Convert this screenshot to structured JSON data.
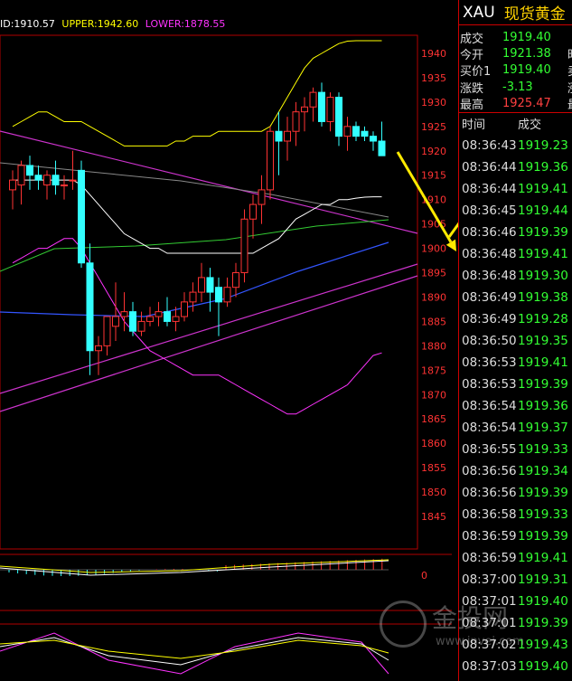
{
  "indicator": {
    "mid": "ID:1910.57",
    "upper": "UPPER:1942.60",
    "lower": "LOWER:1878.55",
    "colors": {
      "mid": "#ffffff",
      "upper": "#ffff00",
      "lower": "#ff33ff"
    }
  },
  "quote": {
    "symbol": "XAU",
    "name": "现货黄金",
    "rows": [
      {
        "label": "成交",
        "value": "1919.40",
        "extra": ""
      },
      {
        "label": "今开",
        "value": "1921.38",
        "extra": "昨"
      },
      {
        "label": "买价1",
        "value": "1919.40",
        "extra": "卖"
      },
      {
        "label": "涨跌",
        "value": "-3.13",
        "extra": "涨"
      },
      {
        "label": "最高",
        "value": "1925.47",
        "extra": "最"
      }
    ]
  },
  "ticks": {
    "header": {
      "time": "时间",
      "price": "成交"
    },
    "rows": [
      {
        "time": "08:36:43",
        "price": "1919.23"
      },
      {
        "time": "08:36:44",
        "price": "1919.36"
      },
      {
        "time": "08:36:44",
        "price": "1919.41"
      },
      {
        "time": "08:36:45",
        "price": "1919.44"
      },
      {
        "time": "08:36:46",
        "price": "1919.39"
      },
      {
        "time": "08:36:48",
        "price": "1919.41"
      },
      {
        "time": "08:36:48",
        "price": "1919.30"
      },
      {
        "time": "08:36:49",
        "price": "1919.38"
      },
      {
        "time": "08:36:49",
        "price": "1919.28"
      },
      {
        "time": "08:36:50",
        "price": "1919.35"
      },
      {
        "time": "08:36:53",
        "price": "1919.41"
      },
      {
        "time": "08:36:53",
        "price": "1919.39"
      },
      {
        "time": "08:36:54",
        "price": "1919.36"
      },
      {
        "time": "08:36:54",
        "price": "1919.37"
      },
      {
        "time": "08:36:55",
        "price": "1919.33"
      },
      {
        "time": "08:36:56",
        "price": "1919.34"
      },
      {
        "time": "08:36:56",
        "price": "1919.39"
      },
      {
        "time": "08:36:58",
        "price": "1919.33"
      },
      {
        "time": "08:36:59",
        "price": "1919.39"
      },
      {
        "time": "08:36:59",
        "price": "1919.41"
      },
      {
        "time": "08:37:00",
        "price": "1919.31"
      },
      {
        "time": "08:37:01",
        "price": "1919.40"
      },
      {
        "time": "08:37:01",
        "price": "1919.39"
      },
      {
        "time": "08:37:02",
        "price": "1919.43"
      },
      {
        "time": "08:37:03",
        "price": "1919.40"
      }
    ]
  },
  "watermark": {
    "text": "金投网",
    "url": "www.jnvei.com"
  },
  "chart_data": {
    "type": "candlestick",
    "ylim": [
      1840,
      1945
    ],
    "y_ticks": [
      1940,
      1935,
      1930,
      1925,
      1920,
      1915,
      1910,
      1905,
      1900,
      1895,
      1890,
      1885,
      1880,
      1875,
      1870,
      1865,
      1860,
      1855,
      1850,
      1845
    ],
    "candles": [
      {
        "o": 1912,
        "h": 1916,
        "l": 1908,
        "c": 1914
      },
      {
        "o": 1913,
        "h": 1918,
        "l": 1909,
        "c": 1917
      },
      {
        "o": 1917,
        "h": 1919,
        "l": 1912,
        "c": 1915
      },
      {
        "o": 1915,
        "h": 1917,
        "l": 1912,
        "c": 1914
      },
      {
        "o": 1913,
        "h": 1916,
        "l": 1910,
        "c": 1915
      },
      {
        "o": 1915,
        "h": 1918,
        "l": 1911,
        "c": 1913
      },
      {
        "o": 1913,
        "h": 1915,
        "l": 1910,
        "c": 1913
      },
      {
        "o": 1914,
        "h": 1920,
        "l": 1912,
        "c": 1914
      },
      {
        "o": 1916,
        "h": 1918,
        "l": 1896,
        "c": 1897
      },
      {
        "o": 1897,
        "h": 1901,
        "l": 1874,
        "c": 1879
      },
      {
        "o": 1879,
        "h": 1882,
        "l": 1874,
        "c": 1880
      },
      {
        "o": 1880,
        "h": 1886,
        "l": 1878,
        "c": 1886
      },
      {
        "o": 1884,
        "h": 1893,
        "l": 1881,
        "c": 1886
      },
      {
        "o": 1886,
        "h": 1891,
        "l": 1883,
        "c": 1887
      },
      {
        "o": 1887,
        "h": 1889,
        "l": 1882,
        "c": 1883
      },
      {
        "o": 1883,
        "h": 1887,
        "l": 1882,
        "c": 1885
      },
      {
        "o": 1885,
        "h": 1888,
        "l": 1884,
        "c": 1886
      },
      {
        "o": 1886,
        "h": 1889,
        "l": 1884,
        "c": 1887
      },
      {
        "o": 1887,
        "h": 1890,
        "l": 1884,
        "c": 1885
      },
      {
        "o": 1885,
        "h": 1888,
        "l": 1883,
        "c": 1886
      },
      {
        "o": 1886,
        "h": 1891,
        "l": 1885,
        "c": 1889
      },
      {
        "o": 1889,
        "h": 1893,
        "l": 1887,
        "c": 1891
      },
      {
        "o": 1891,
        "h": 1897,
        "l": 1889,
        "c": 1894
      },
      {
        "o": 1894,
        "h": 1896,
        "l": 1887,
        "c": 1891
      },
      {
        "o": 1892,
        "h": 1894,
        "l": 1882,
        "c": 1889
      },
      {
        "o": 1889,
        "h": 1894,
        "l": 1888,
        "c": 1892
      },
      {
        "o": 1892,
        "h": 1897,
        "l": 1890,
        "c": 1895
      },
      {
        "o": 1895,
        "h": 1908,
        "l": 1893,
        "c": 1906
      },
      {
        "o": 1906,
        "h": 1911,
        "l": 1902,
        "c": 1909
      },
      {
        "o": 1909,
        "h": 1915,
        "l": 1905,
        "c": 1912
      },
      {
        "o": 1912,
        "h": 1925,
        "l": 1910,
        "c": 1924
      },
      {
        "o": 1924,
        "h": 1928,
        "l": 1915,
        "c": 1922
      },
      {
        "o": 1922,
        "h": 1927,
        "l": 1918,
        "c": 1924
      },
      {
        "o": 1924,
        "h": 1930,
        "l": 1921,
        "c": 1928
      },
      {
        "o": 1928,
        "h": 1931,
        "l": 1924,
        "c": 1929
      },
      {
        "o": 1929,
        "h": 1933,
        "l": 1926,
        "c": 1932
      },
      {
        "o": 1932,
        "h": 1934,
        "l": 1925,
        "c": 1926
      },
      {
        "o": 1926,
        "h": 1932,
        "l": 1924,
        "c": 1931
      },
      {
        "o": 1931,
        "h": 1932,
        "l": 1921,
        "c": 1923
      },
      {
        "o": 1923,
        "h": 1927,
        "l": 1920,
        "c": 1925
      },
      {
        "o": 1925,
        "h": 1926,
        "l": 1922,
        "c": 1923
      },
      {
        "o": 1924,
        "h": 1925,
        "l": 1922,
        "c": 1923
      },
      {
        "o": 1923,
        "h": 1924,
        "l": 1920,
        "c": 1922
      },
      {
        "o": 1922,
        "h": 1926,
        "l": 1919,
        "c": 1919
      }
    ],
    "bands": {
      "upper": [
        1925,
        1926,
        1927,
        1928,
        1928,
        1927,
        1926,
        1926,
        1926,
        1925,
        1924,
        1923,
        1922,
        1921,
        1921,
        1921,
        1921,
        1921,
        1921,
        1922,
        1922,
        1923,
        1923,
        1923,
        1924,
        1924,
        1924,
        1924,
        1924,
        1924,
        1925,
        1928,
        1931,
        1934,
        1937,
        1939,
        1940,
        1941,
        1942,
        1942.5,
        1942.6,
        1942.6,
        1942.6,
        1942.6
      ],
      "mid": [
        1914,
        1914,
        1914,
        1914,
        1914,
        1914,
        1914,
        1914,
        1913,
        1911,
        1909,
        1907,
        1905,
        1903,
        1902,
        1901,
        1900,
        1900,
        1899,
        1899,
        1899,
        1899,
        1899,
        1899,
        1899,
        1899,
        1899,
        1899,
        1899,
        1900,
        1901,
        1902,
        1904,
        1906,
        1907,
        1908,
        1909,
        1909,
        1910,
        1910,
        1910.3,
        1910.5,
        1910.57,
        1910.57
      ],
      "lower": [
        1897,
        1898,
        1899,
        1900,
        1900,
        1901,
        1902,
        1902,
        1900,
        1897,
        1894,
        1891,
        1888,
        1885,
        1883,
        1881,
        1879,
        1878,
        1877,
        1876,
        1875,
        1874,
        1874,
        1874,
        1874,
        1873,
        1872,
        1871,
        1870,
        1869,
        1868,
        1867,
        1866,
        1866,
        1867,
        1868,
        1869,
        1870,
        1871,
        1872,
        1874,
        1876,
        1878,
        1878.55
      ]
    }
  }
}
